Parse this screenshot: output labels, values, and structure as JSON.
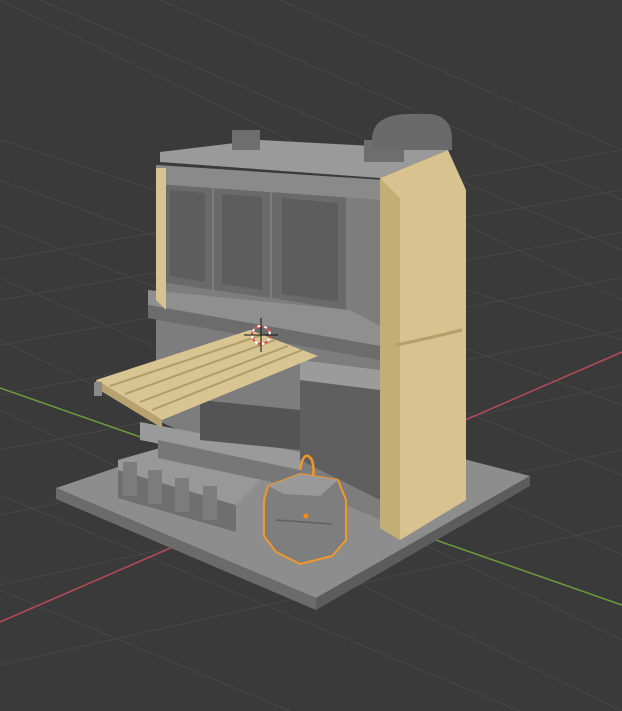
{
  "viewport": {
    "background_color": "#3a3a3a",
    "grid_line_color": "#4a4a4a",
    "x_axis_color": "#b54a57",
    "y_axis_color": "#6d9a3d",
    "selection_outline_color": "#f0982a"
  },
  "scene": {
    "objects": [
      {
        "name": "shop-building",
        "material": "grey-concrete",
        "color": "#8a8a8a"
      },
      {
        "name": "sandstone-corner-pillar",
        "material": "sandstone",
        "color": "#d5c08e"
      },
      {
        "name": "striped-awning",
        "material": "sandstone",
        "color": "#d6c390"
      },
      {
        "name": "ground-base-plate",
        "material": "grey-concrete",
        "color": "#8c8c8c"
      },
      {
        "name": "bollard-row",
        "material": "grey-concrete",
        "color": "#8a8a8a"
      },
      {
        "name": "lantern-object",
        "material": "grey-concrete",
        "color": "#7e7e7e",
        "selected": true
      }
    ],
    "gizmos": [
      {
        "name": "3d-cursor",
        "icon": "3d-cursor-icon"
      },
      {
        "name": "object-origin",
        "icon": "origin-dot-icon"
      }
    ]
  }
}
